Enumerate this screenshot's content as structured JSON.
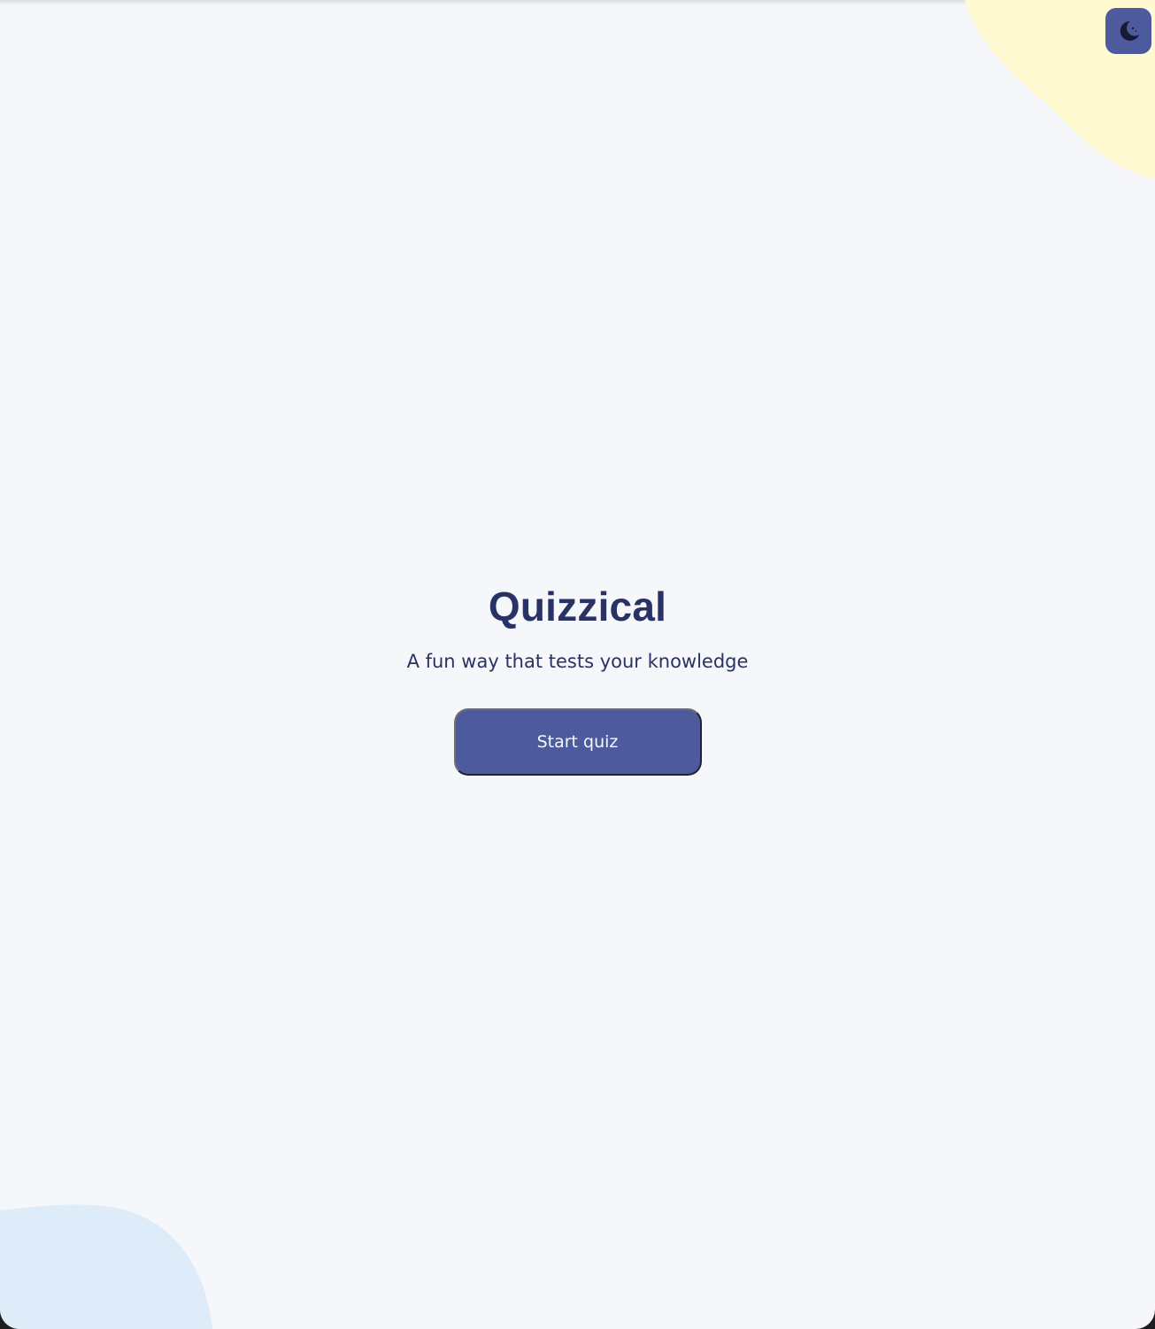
{
  "app": {
    "title": "Quizzical",
    "subtitle": "A fun way that tests your knowledge",
    "start_button_label": "Start quiz"
  },
  "theme_toggle": {
    "icon": "moon-icon"
  },
  "colors": {
    "background": "#f5f7fb",
    "primary": "#4d5b9e",
    "text": "#293264",
    "blob_yellow": "#fffad1",
    "blob_blue": "#deebf8"
  }
}
